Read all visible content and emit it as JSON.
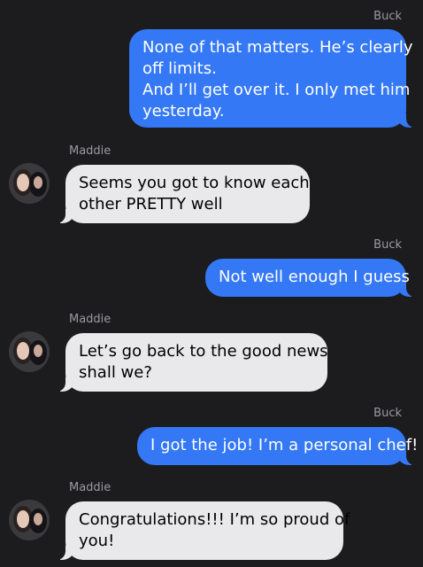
{
  "conversation": {
    "messages": [
      {
        "sender": "Buck",
        "direction": "outgoing",
        "lines": [
          "None of that matters. He’s clearly",
          "off limits.",
          "And I’ll get over it. I only met him",
          "yesterday."
        ]
      },
      {
        "sender": "Maddie",
        "direction": "incoming",
        "lines": [
          "Seems you got to know each",
          "other PRETTY well"
        ]
      },
      {
        "sender": "Buck",
        "direction": "outgoing",
        "lines": [
          "Not well enough I guess"
        ]
      },
      {
        "sender": "Maddie",
        "direction": "incoming",
        "lines": [
          "Let’s go back to the good news",
          "shall we?"
        ]
      },
      {
        "sender": "Buck",
        "direction": "outgoing",
        "lines": [
          "I got the job! I’m a personal chef!"
        ]
      },
      {
        "sender": "Maddie",
        "direction": "incoming",
        "lines": [
          "Congratulations!!! I’m so proud of",
          "you!"
        ]
      }
    ]
  },
  "colors": {
    "background": "#1c1c1e",
    "outgoing_bubble": "#3478f6",
    "incoming_bubble": "#e9e9eb",
    "sender_name": "#9a9aa0"
  }
}
